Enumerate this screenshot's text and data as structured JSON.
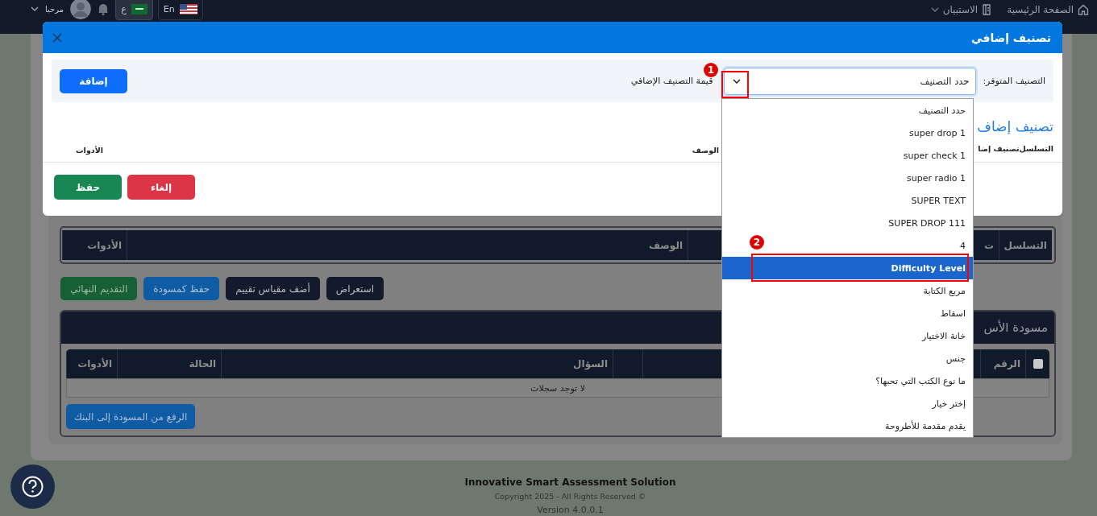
{
  "navbar": {
    "greeting": "مرحبا",
    "languages": [
      {
        "label": "En",
        "kind": "english",
        "selected": false
      },
      {
        "label": "ع",
        "kind": "arabic",
        "selected": true
      }
    ],
    "menu": [
      {
        "label": "الصفحة الرئيسية",
        "kind": "home",
        "dropdown": false
      },
      {
        "label": "الاستبيان",
        "kind": "book",
        "dropdown": true
      }
    ]
  },
  "page": {
    "classification_table": {
      "columns": [
        "التسلسل",
        "ت",
        "الوصف",
        "الأدوات"
      ]
    },
    "actions": [
      {
        "label": "استعراض",
        "kind": "dark"
      },
      {
        "label": "أضف مقياس تقييم",
        "kind": "dark"
      },
      {
        "label": "حفظ كمسودة",
        "kind": "primary"
      },
      {
        "label": "التقديم النهائي",
        "kind": "success"
      }
    ],
    "draft": {
      "title": "مسودة الأس",
      "columns": [
        {
          "kind": "checkbox",
          "checked": false
        },
        {
          "kind": "text",
          "label": "الرقم"
        },
        {
          "kind": "blank"
        },
        {
          "kind": "blank"
        },
        {
          "kind": "text",
          "label": "السؤال"
        },
        {
          "kind": "text",
          "label": "الحالة"
        },
        {
          "kind": "text",
          "label": "الأدوات"
        }
      ],
      "empty_message": "لا توجد سجلات",
      "upload_button": "الرفع من المسودة إلى البنك"
    }
  },
  "modal": {
    "title": "تصنيف إضافي",
    "filter": {
      "label": "التصنيف المتوفر:",
      "select_value": "حدد التصنيف",
      "value_label": "قيمة التصنيف الإضافي",
      "add_button": "إضافة",
      "options": [
        {
          "label": "حدد التصنيف",
          "selected": false
        },
        {
          "label": "super drop 1",
          "selected": false
        },
        {
          "label": "super check 1",
          "selected": false
        },
        {
          "label": "super radio 1",
          "selected": false
        },
        {
          "label": "SUPER TEXT",
          "selected": false
        },
        {
          "label": "SUPER DROP 111",
          "selected": false
        },
        {
          "label": "4",
          "selected": false
        },
        {
          "label": "Difficulty Level",
          "selected": true
        },
        {
          "label": "مربع الكتابة",
          "selected": false
        },
        {
          "label": "اسقاط",
          "selected": false
        },
        {
          "label": "خانة الاختيار",
          "selected": false
        },
        {
          "label": "جنس",
          "selected": false
        },
        {
          "label": "ما نوع الكتب التي تحبها؟",
          "selected": false
        },
        {
          "label": "إختر خيار",
          "selected": false
        },
        {
          "label": "يقدم مقدمة للأطروحة",
          "selected": false
        }
      ]
    },
    "section_title": "تصنيف إضاف",
    "columns": [
      "التسلسل",
      "تصنيف إضا",
      "الوصف",
      "الأدوات"
    ],
    "cancel_button": "إلغاء",
    "save_button": "حفظ"
  },
  "annotations": [
    {
      "number": "1"
    },
    {
      "number": "2"
    }
  ],
  "footer": {
    "title": "Innovative Smart Assessment Solution",
    "copyright": "Copyright 2025 - All Rights Reserved ©",
    "version": "Version 4.0.0.1"
  }
}
